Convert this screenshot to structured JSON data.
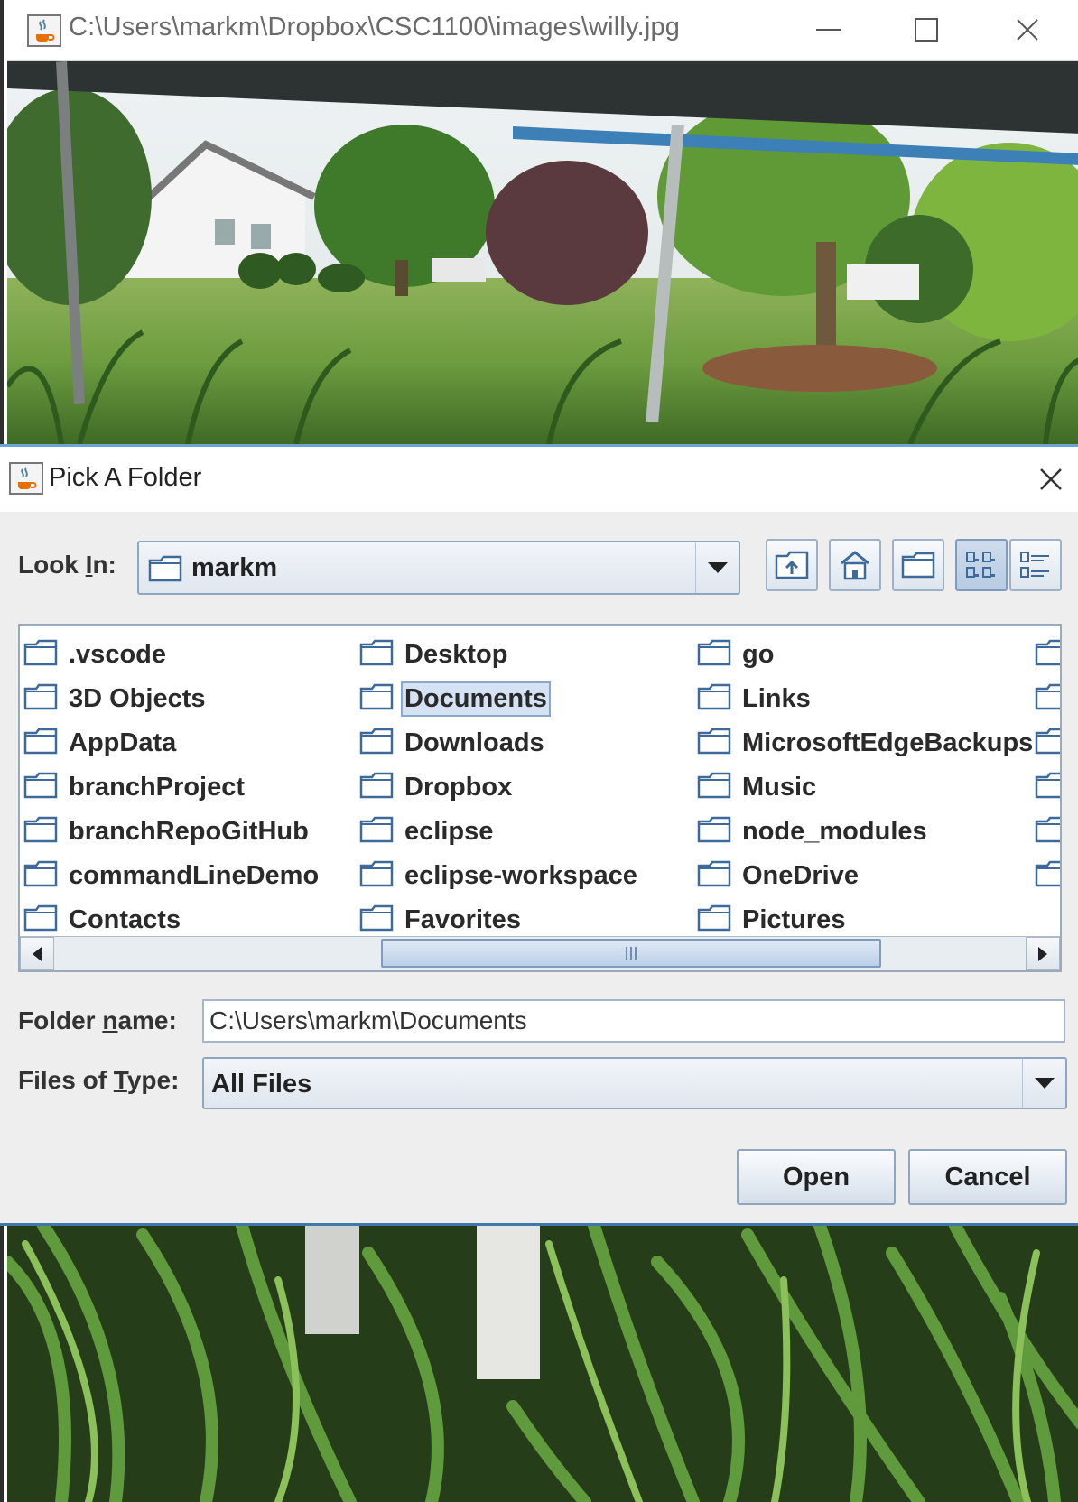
{
  "image_window": {
    "title": "C:\\Users\\markm\\Dropbox\\CSC1100\\images\\willy.jpg",
    "icons": {
      "app": "java-cup-icon",
      "minimize": "minimize-icon",
      "maximize": "maximize-icon",
      "close": "close-icon"
    }
  },
  "dialog": {
    "title": "Pick A Folder",
    "look_in": {
      "label_pre": "Look ",
      "label_key": "I",
      "label_post": "n:",
      "value": "markm"
    },
    "toolbar": [
      "up-one-level-icon",
      "home-icon",
      "new-folder-icon",
      "list-view-icon",
      "details-view-icon"
    ],
    "files": {
      "columns": [
        [
          ".vscode",
          "3D Objects",
          "AppData",
          "branchProject",
          "branchRepoGitHub",
          "commandLineDemo",
          "Contacts"
        ],
        [
          "Desktop",
          "Documents",
          "Downloads",
          "Dropbox",
          "eclipse",
          "eclipse-workspace",
          "Favorites"
        ],
        [
          "go",
          "Links",
          "MicrosoftEdgeBackups",
          "Music",
          "node_modules",
          "OneDrive",
          "Pictures"
        ]
      ],
      "selected": "Documents"
    },
    "folder_name": {
      "label_pre": "Folder ",
      "label_key": "n",
      "label_post": "ame:",
      "value": "C:\\Users\\markm\\Documents"
    },
    "files_of_type": {
      "label_pre": "Files of ",
      "label_key": "T",
      "label_post": "ype:",
      "value": "All Files"
    },
    "buttons": {
      "open": "Open",
      "cancel": "Cancel"
    }
  }
}
